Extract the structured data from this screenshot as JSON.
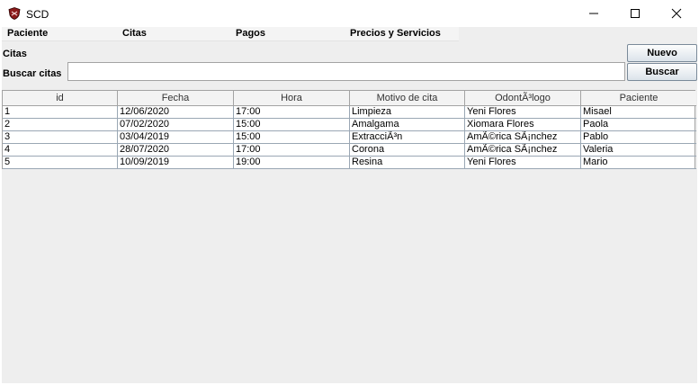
{
  "window": {
    "title": "SCD",
    "minimize": "—",
    "maximize": "☐",
    "close": "✕"
  },
  "menu": {
    "items": [
      {
        "label": "Paciente"
      },
      {
        "label": "Citas"
      },
      {
        "label": "Pagos"
      },
      {
        "label": "Precios y Servicios"
      }
    ]
  },
  "panel": {
    "section_label": "Citas",
    "search_label": "Buscar citas",
    "search_value": "",
    "new_button": "Nuevo",
    "search_button": "Buscar"
  },
  "table": {
    "columns": [
      "id",
      "Fecha",
      "Hora",
      "Motivo de cita",
      "OdontÃ³logo",
      "Paciente"
    ],
    "rows": [
      [
        "1",
        "12/06/2020",
        "17:00",
        "Limpieza",
        "Yeni Flores",
        "Misael"
      ],
      [
        "2",
        "07/02/2020",
        "15:00",
        "Amalgama",
        "Xiomara Flores",
        "Paola"
      ],
      [
        "3",
        "03/04/2019",
        "15:00",
        "ExtracciÃ³n",
        "AmÃ©rica SÃ¡nchez",
        "Pablo"
      ],
      [
        "4",
        "28/07/2020",
        "17:00",
        "Corona",
        "AmÃ©rica SÃ¡nchez",
        "Valeria"
      ],
      [
        "5",
        "10/09/2019",
        "19:00",
        "Resina",
        "Yeni Flores",
        "Mario"
      ]
    ]
  },
  "colors": {
    "window_bg": "#eeeeee",
    "app_icon": "#8b1a1a",
    "grid_line": "#9aa7b4"
  },
  "icons": {
    "app": "shield-icon"
  }
}
